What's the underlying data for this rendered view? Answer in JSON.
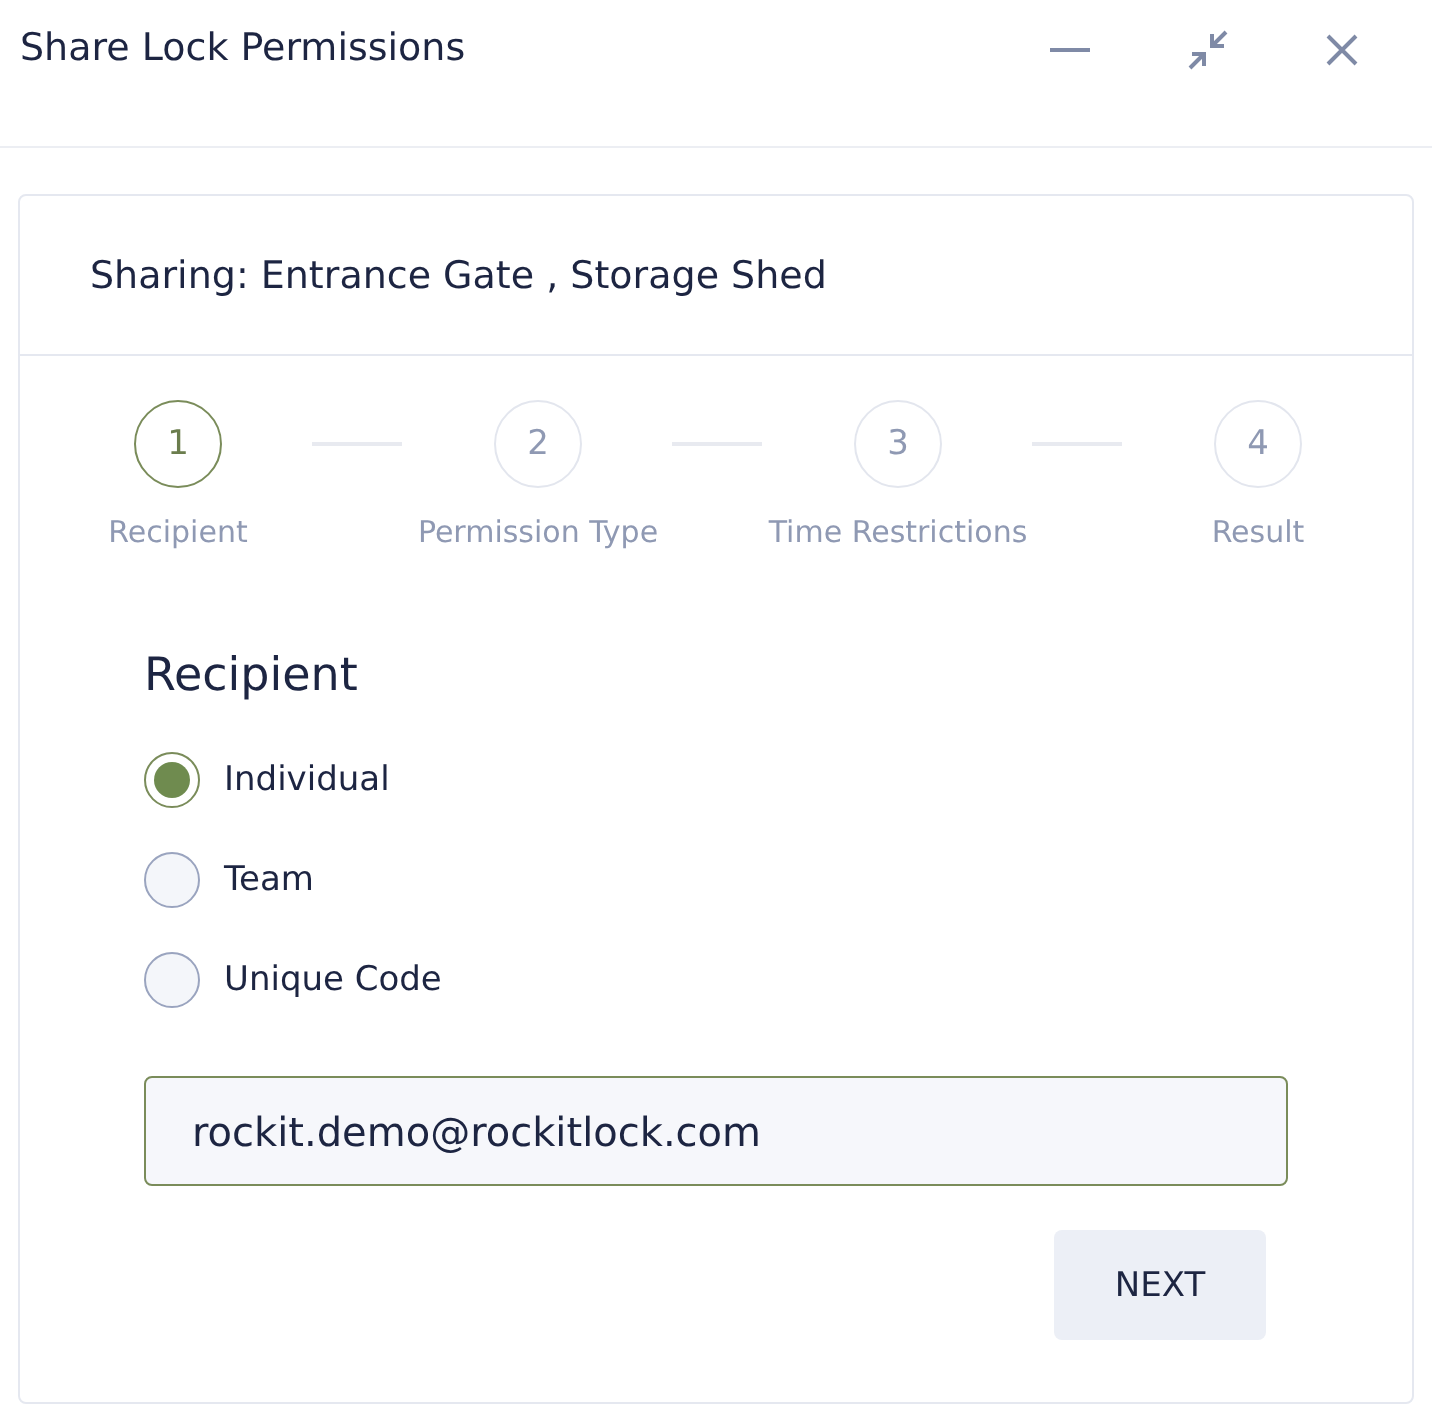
{
  "window": {
    "title": "Share Lock Permissions"
  },
  "card": {
    "title": "Sharing: Entrance Gate , Storage Shed"
  },
  "steps": [
    {
      "number": "1",
      "label": "Recipient",
      "selected": true
    },
    {
      "number": "2",
      "label": "Permission Type",
      "selected": false
    },
    {
      "number": "3",
      "label": "Time Restrictions",
      "selected": false
    },
    {
      "number": "4",
      "label": "Result",
      "selected": false
    }
  ],
  "section_title": "Recipient",
  "options": [
    {
      "label": "Individual",
      "selected": true
    },
    {
      "label": "Team",
      "selected": false
    },
    {
      "label": "Unique Code",
      "selected": false
    }
  ],
  "email_field": {
    "value": "rockit.demo@rockitlock.com"
  },
  "buttons": [
    "NEXT"
  ]
}
